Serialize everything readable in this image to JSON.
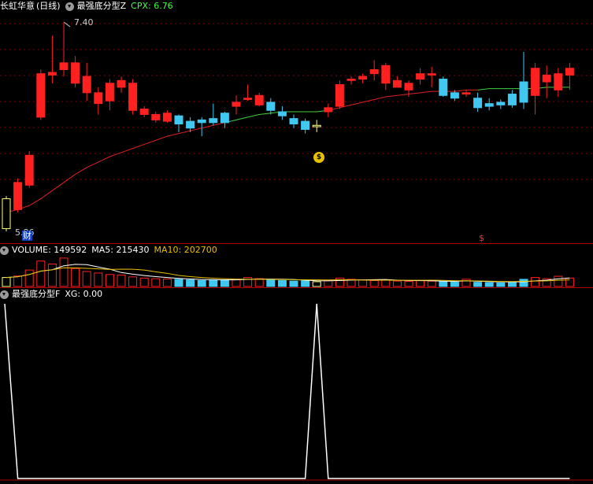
{
  "price_panel": {
    "stock_name": "长虹华意",
    "period": "(日线)",
    "indicator_name": "最强底分型Z",
    "cpx_label": "CPX: 6.76",
    "high_label": "7.40",
    "low_label": "5.86",
    "badge_text": "财",
    "dollar_text": "$",
    "bag_text": "$"
  },
  "volume_panel": {
    "volume_label": "VOLUME: 149592",
    "ma5_label": "MA5: 215430",
    "ma10_label": "MA10: 202700"
  },
  "xg_panel": {
    "indicator_name": "最强底分型F",
    "xg_label": "XG: 0.00"
  },
  "colors": {
    "up": "#ff2020",
    "down": "#40c8f0",
    "yellow": "#ffff80",
    "ma_red": "#e02020",
    "ma_green": "#40d040",
    "grid": "#800000",
    "cpx": "#40ff40",
    "ma10": "#e8c000"
  },
  "chart_data": {
    "type": "candlestick",
    "price_range": [
      5.86,
      7.4
    ],
    "candles": [
      {
        "o": 5.88,
        "h": 6.12,
        "l": 5.86,
        "c": 6.1,
        "k": "y"
      },
      {
        "o": 6.02,
        "h": 6.25,
        "l": 6.0,
        "c": 6.22,
        "k": "u"
      },
      {
        "o": 6.2,
        "h": 6.45,
        "l": 6.18,
        "c": 6.42,
        "k": "u"
      },
      {
        "o": 6.7,
        "h": 7.05,
        "l": 6.68,
        "c": 7.02,
        "k": "u"
      },
      {
        "o": 7.01,
        "h": 7.3,
        "l": 6.95,
        "c": 7.03,
        "k": "u"
      },
      {
        "o": 7.05,
        "h": 7.4,
        "l": 7.0,
        "c": 7.1,
        "k": "u"
      },
      {
        "o": 7.1,
        "h": 7.15,
        "l": 6.92,
        "c": 6.95,
        "k": "u"
      },
      {
        "o": 7.0,
        "h": 7.1,
        "l": 6.82,
        "c": 6.88,
        "k": "u"
      },
      {
        "o": 6.88,
        "h": 6.92,
        "l": 6.72,
        "c": 6.8,
        "k": "u"
      },
      {
        "o": 6.82,
        "h": 6.98,
        "l": 6.75,
        "c": 6.95,
        "k": "u"
      },
      {
        "o": 6.92,
        "h": 7.0,
        "l": 6.88,
        "c": 6.97,
        "k": "u"
      },
      {
        "o": 6.95,
        "h": 6.98,
        "l": 6.72,
        "c": 6.75,
        "k": "u"
      },
      {
        "o": 6.76,
        "h": 6.78,
        "l": 6.7,
        "c": 6.72,
        "k": "u"
      },
      {
        "o": 6.72,
        "h": 6.74,
        "l": 6.66,
        "c": 6.68,
        "k": "u"
      },
      {
        "o": 6.73,
        "h": 6.75,
        "l": 6.66,
        "c": 6.67,
        "k": "u"
      },
      {
        "o": 6.71,
        "h": 6.72,
        "l": 6.59,
        "c": 6.65,
        "k": "d"
      },
      {
        "o": 6.67,
        "h": 6.7,
        "l": 6.59,
        "c": 6.62,
        "k": "d"
      },
      {
        "o": 6.68,
        "h": 6.7,
        "l": 6.56,
        "c": 6.66,
        "k": "d"
      },
      {
        "o": 6.69,
        "h": 6.8,
        "l": 6.64,
        "c": 6.66,
        "k": "d"
      },
      {
        "o": 6.66,
        "h": 6.74,
        "l": 6.62,
        "c": 6.73,
        "k": "d"
      },
      {
        "o": 6.78,
        "h": 6.86,
        "l": 6.72,
        "c": 6.81,
        "k": "u"
      },
      {
        "o": 6.84,
        "h": 6.94,
        "l": 6.82,
        "c": 6.83,
        "k": "u"
      },
      {
        "o": 6.86,
        "h": 6.88,
        "l": 6.78,
        "c": 6.79,
        "k": "u"
      },
      {
        "o": 6.81,
        "h": 6.84,
        "l": 6.72,
        "c": 6.75,
        "k": "d"
      },
      {
        "o": 6.74,
        "h": 6.78,
        "l": 6.68,
        "c": 6.71,
        "k": "d"
      },
      {
        "o": 6.69,
        "h": 6.72,
        "l": 6.62,
        "c": 6.65,
        "k": "d"
      },
      {
        "o": 6.67,
        "h": 6.69,
        "l": 6.58,
        "c": 6.61,
        "k": "d"
      },
      {
        "o": 6.63,
        "h": 6.68,
        "l": 6.59,
        "c": 6.64,
        "k": "y"
      },
      {
        "o": 6.74,
        "h": 6.8,
        "l": 6.7,
        "c": 6.77,
        "k": "u"
      },
      {
        "o": 6.78,
        "h": 6.97,
        "l": 6.76,
        "c": 6.94,
        "k": "u"
      },
      {
        "o": 6.97,
        "h": 7.0,
        "l": 6.94,
        "c": 6.98,
        "k": "u"
      },
      {
        "o": 6.98,
        "h": 7.02,
        "l": 6.95,
        "c": 7.0,
        "k": "u"
      },
      {
        "o": 7.02,
        "h": 7.12,
        "l": 6.97,
        "c": 7.05,
        "k": "u"
      },
      {
        "o": 7.08,
        "h": 7.1,
        "l": 6.9,
        "c": 6.95,
        "k": "u"
      },
      {
        "o": 6.97,
        "h": 7.0,
        "l": 6.92,
        "c": 6.92,
        "k": "u"
      },
      {
        "o": 6.95,
        "h": 6.97,
        "l": 6.85,
        "c": 6.9,
        "k": "u"
      },
      {
        "o": 6.98,
        "h": 7.06,
        "l": 6.94,
        "c": 7.02,
        "k": "u"
      },
      {
        "o": 7.02,
        "h": 7.07,
        "l": 6.92,
        "c": 7.01,
        "k": "u"
      },
      {
        "o": 6.98,
        "h": 7.0,
        "l": 6.85,
        "c": 6.86,
        "k": "d"
      },
      {
        "o": 6.88,
        "h": 6.9,
        "l": 6.82,
        "c": 6.84,
        "k": "d"
      },
      {
        "o": 6.88,
        "h": 6.9,
        "l": 6.85,
        "c": 6.87,
        "k": "u"
      },
      {
        "o": 6.84,
        "h": 6.88,
        "l": 6.74,
        "c": 6.77,
        "k": "d"
      },
      {
        "o": 6.8,
        "h": 6.84,
        "l": 6.75,
        "c": 6.78,
        "k": "d"
      },
      {
        "o": 6.79,
        "h": 6.83,
        "l": 6.76,
        "c": 6.81,
        "k": "d"
      },
      {
        "o": 6.79,
        "h": 6.9,
        "l": 6.77,
        "c": 6.87,
        "k": "d"
      },
      {
        "o": 6.81,
        "h": 7.18,
        "l": 6.76,
        "c": 6.96,
        "k": "d"
      },
      {
        "o": 6.86,
        "h": 7.1,
        "l": 6.72,
        "c": 7.06,
        "k": "u"
      },
      {
        "o": 7.01,
        "h": 7.08,
        "l": 6.84,
        "c": 6.96,
        "k": "u"
      },
      {
        "o": 6.9,
        "h": 7.06,
        "l": 6.85,
        "c": 7.02,
        "k": "u"
      },
      {
        "o": 7.06,
        "h": 7.1,
        "l": 6.9,
        "c": 7.01,
        "k": "u"
      }
    ],
    "ma_line": [
      6.0,
      6.02,
      6.05,
      6.1,
      6.16,
      6.22,
      6.28,
      6.33,
      6.37,
      6.41,
      6.44,
      6.47,
      6.5,
      6.53,
      6.56,
      6.58,
      6.6,
      6.62,
      6.64,
      6.66,
      6.68,
      6.7,
      6.72,
      6.73,
      6.74,
      6.74,
      6.74,
      6.74,
      6.75,
      6.77,
      6.79,
      6.81,
      6.83,
      6.85,
      6.86,
      6.87,
      6.88,
      6.89,
      6.89,
      6.89,
      6.9,
      6.9,
      6.91,
      6.91,
      6.91,
      6.91,
      6.91,
      6.92,
      6.92,
      6.92
    ],
    "volumes": [
      0.3,
      0.35,
      0.55,
      0.85,
      0.75,
      0.95,
      0.6,
      0.5,
      0.45,
      0.4,
      0.38,
      0.32,
      0.28,
      0.26,
      0.25,
      0.24,
      0.22,
      0.2,
      0.22,
      0.22,
      0.24,
      0.3,
      0.26,
      0.22,
      0.2,
      0.18,
      0.19,
      0.16,
      0.2,
      0.28,
      0.24,
      0.22,
      0.2,
      0.22,
      0.18,
      0.17,
      0.2,
      0.18,
      0.16,
      0.15,
      0.24,
      0.14,
      0.13,
      0.12,
      0.14,
      0.24,
      0.3,
      0.26,
      0.34,
      0.28
    ],
    "xg_series": [
      1,
      0,
      0,
      0,
      0,
      0,
      0,
      0,
      0,
      0,
      0,
      0,
      0,
      0,
      0,
      0,
      0,
      0,
      0,
      0,
      0,
      0,
      0,
      0,
      0,
      0,
      0,
      1,
      0,
      0,
      0,
      0,
      0,
      0,
      0,
      0,
      0,
      0,
      0,
      0,
      0,
      0,
      0,
      0,
      0,
      0,
      0,
      0,
      0,
      0
    ]
  }
}
